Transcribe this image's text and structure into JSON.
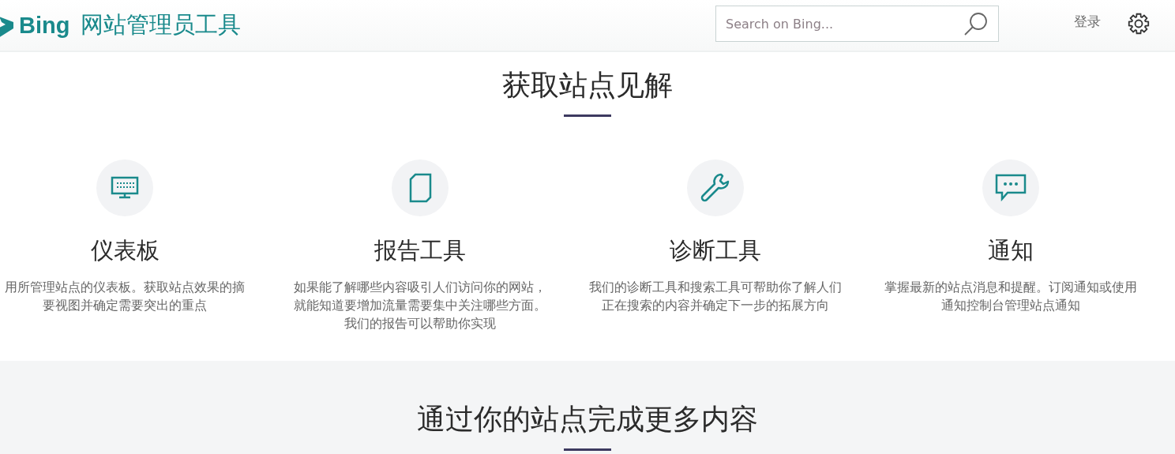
{
  "header": {
    "brand": "Bing",
    "product": "网站管理员工具",
    "search": {
      "placeholder": "Search on Bing..."
    },
    "login": "登录"
  },
  "insights": {
    "title": "获取站点见解",
    "features": [
      {
        "kind": "monitor",
        "title": "仪表板",
        "description": [
          "用所管理站点的仪表板。获取站点效果的摘",
          "要视图并确定需要突出的重点"
        ]
      },
      {
        "kind": "document",
        "title": "报告工具",
        "description": [
          "如果能了解哪些内容吸引人们访问你的网站，",
          "就能知道要增加流量需要集中关注哪些方面。",
          "我们的报告可以帮助你实现"
        ]
      },
      {
        "kind": "wrench",
        "title": "诊断工具",
        "description": [
          "我们的诊断工具和搜索工具可帮助你了解人们",
          "正在搜索的内容并确定下一步的拓展方向"
        ]
      },
      {
        "kind": "chat",
        "title": "通知",
        "description": [
          "掌握最新的站点消息和提醒。订阅通知或使用",
          "通知控制台管理站点通知"
        ]
      }
    ]
  },
  "more": {
    "title": "通过你的站点完成更多内容"
  }
}
